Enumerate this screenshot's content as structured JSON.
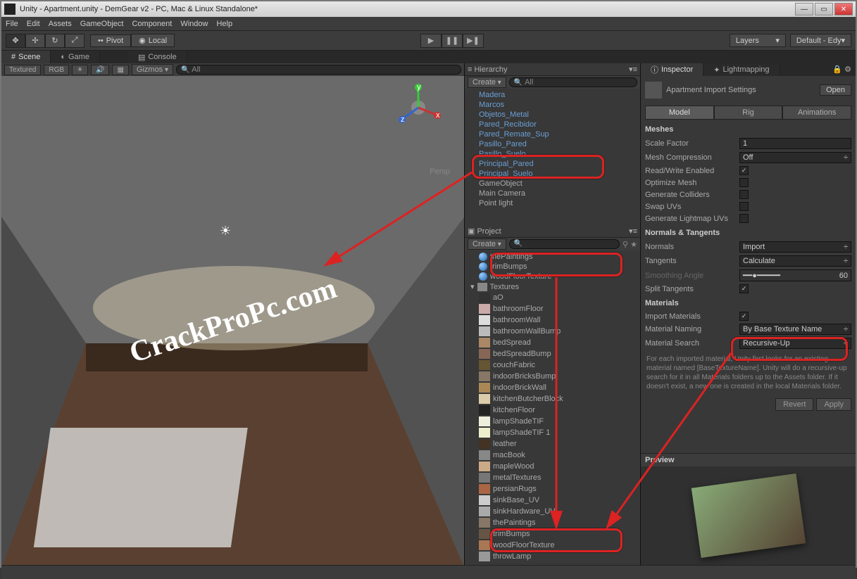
{
  "window": {
    "title": "Unity - Apartment.unity - DemGear v2 - PC, Mac & Linux Standalone*"
  },
  "menu": [
    "File",
    "Edit",
    "Assets",
    "GameObject",
    "Component",
    "Window",
    "Help"
  ],
  "toolbar": {
    "pivot": "Pivot",
    "local": "Local",
    "layers": "Layers",
    "layout": "Default - Edy"
  },
  "sceneTabs": {
    "scene": "Scene",
    "game": "Game",
    "console": "Console"
  },
  "sceneToolbar": {
    "textured": "Textured",
    "rgb": "RGB",
    "gizmos": "Gizmos",
    "all": "All"
  },
  "viewport": {
    "persp": "Persp",
    "watermark": "CrackProPc.com"
  },
  "hierarchy": {
    "title": "Hierarchy",
    "create": "Create",
    "search": "All",
    "items": [
      {
        "label": "Madera",
        "blue": true
      },
      {
        "label": "Marcos",
        "blue": true
      },
      {
        "label": "Objetos_Metal",
        "blue": true
      },
      {
        "label": "Pared_Recibidor",
        "blue": true
      },
      {
        "label": "Pared_Remate_Sup",
        "blue": true
      },
      {
        "label": "Pasillo_Pared",
        "blue": true
      },
      {
        "label": "Pasillo_Suelo",
        "blue": true
      },
      {
        "label": "Principal_Pared",
        "blue": true
      },
      {
        "label": "Principal_Suelo",
        "blue": true
      },
      {
        "label": "GameObject",
        "blue": false
      },
      {
        "label": "Main Camera",
        "blue": false
      },
      {
        "label": "Point light",
        "blue": false
      }
    ]
  },
  "project": {
    "title": "Project",
    "create": "Create",
    "materials": [
      {
        "label": "thePaintings"
      },
      {
        "label": "trimBumps"
      },
      {
        "label": "woodFloorTexture"
      }
    ],
    "folder": "Textures",
    "textures": [
      "aO",
      "bathroomFloor",
      "bathroomWall",
      "bathroomWallBump",
      "bedSpread",
      "bedSpreadBump",
      "couchFabric",
      "indoorBricksBump",
      "indoorBrickWall",
      "kitchenButcherBlock",
      "kitchenFloor",
      "lampShadeTIF",
      "lampShadeTIF 1",
      "leather",
      "macBook",
      "mapleWood",
      "metalTextures",
      "persianRugs",
      "sinkBase_UV",
      "sinkHardware_UV",
      "thePaintings",
      "trimBumps",
      "woodFloorTexture",
      "throwLamp"
    ]
  },
  "inspector": {
    "tab1": "Inspector",
    "tab2": "Lightmapping",
    "assetTitle": "Apartment Import Settings",
    "open": "Open",
    "tabs": {
      "model": "Model",
      "rig": "Rig",
      "anim": "Animations"
    },
    "meshes": {
      "head": "Meshes",
      "scaleFactor": {
        "label": "Scale Factor",
        "value": "1"
      },
      "meshCompression": {
        "label": "Mesh Compression",
        "value": "Off"
      },
      "readWrite": {
        "label": "Read/Write Enabled",
        "checked": true
      },
      "optimize": {
        "label": "Optimize Mesh",
        "checked": false
      },
      "colliders": {
        "label": "Generate Colliders",
        "checked": false
      },
      "swap": {
        "label": "Swap UVs",
        "checked": false
      },
      "lightmap": {
        "label": "Generate Lightmap UVs",
        "checked": false
      }
    },
    "normals": {
      "head": "Normals & Tangents",
      "normals": {
        "label": "Normals",
        "value": "Import"
      },
      "tangents": {
        "label": "Tangents",
        "value": "Calculate"
      },
      "smoothing": {
        "label": "Smoothing Angle",
        "value": "60"
      },
      "split": {
        "label": "Split Tangents",
        "checked": true
      }
    },
    "materials": {
      "head": "Materials",
      "import": {
        "label": "Import Materials",
        "checked": true
      },
      "naming": {
        "label": "Material Naming",
        "value": "By Base Texture Name"
      },
      "search": {
        "label": "Material Search",
        "value": "Recursive-Up"
      }
    },
    "help": "For each imported material, Unity first looks for an existing material named [BaseTextureName]. Unity will do a recursive-up search for it in all Materials folders up to the Assets folder. If it doesn't exist, a new one is created in the local Materials folder.",
    "revert": "Revert",
    "apply": "Apply",
    "preview": "Preview"
  }
}
